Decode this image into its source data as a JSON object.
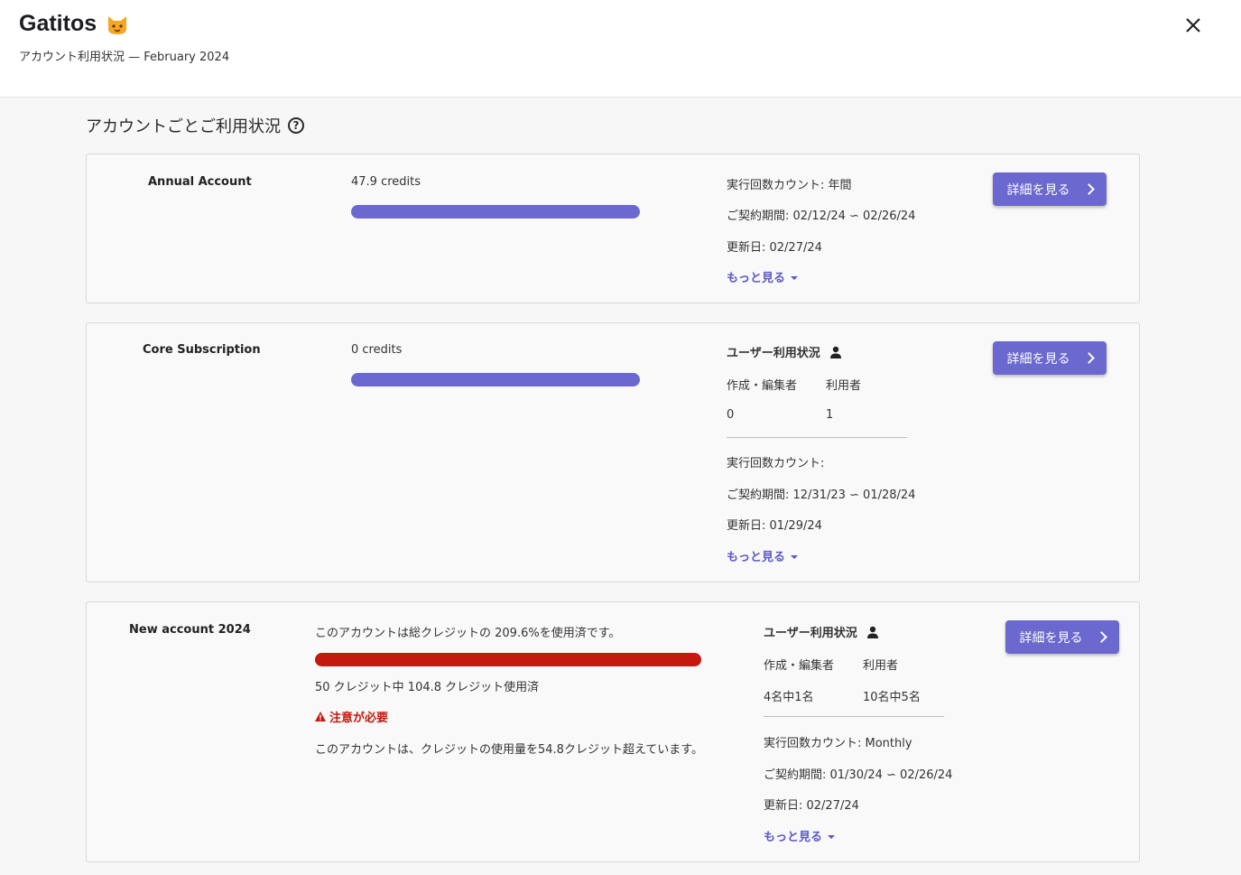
{
  "header": {
    "app_title": "Gatitos",
    "subtitle": "アカウント利用状況 — February 2024"
  },
  "section": {
    "title": "アカウントごとご利用状況"
  },
  "accounts": [
    {
      "name": "Annual Account",
      "credits": "47.9 credits",
      "usage_fraction": 1.0,
      "exec_count": "実行回数カウント: 年間",
      "contract": "ご契約期間: 02/12/24 ∽ 02/26/24",
      "renewal": "更新日: 02/27/24",
      "more_label": "もっと見る",
      "detail_label": "詳細を見る"
    },
    {
      "name": "Core Subscription",
      "credits": "0 credits",
      "usage_fraction": 1.0,
      "user_usage_title": "ユーザー利用状況",
      "editors_label": "作成・編集者",
      "users_label": "利用者",
      "editors_value": "0",
      "users_value": "1",
      "exec_count": "実行回数カウント:",
      "contract": "ご契約期間: 12/31/23 ∽ 01/28/24",
      "renewal": "更新日: 01/29/24",
      "more_label": "もっと見る",
      "detail_label": "詳細を見る"
    },
    {
      "name": "New account 2024",
      "usage_text": "このアカウントは総クレジットの 209.6%を使用済です。",
      "usage_fraction": 1.0,
      "credits_used_text": "50 クレジット中 104.8 クレジット使用済",
      "warning_label": "注意が必要",
      "warning_text": "このアカウントは、クレジットの使用量を54.8クレジット超えています。",
      "user_usage_title": "ユーザー利用状況",
      "editors_label": "作成・編集者",
      "users_label": "利用者",
      "editors_value": "4名中1名",
      "users_value": "10名中5名",
      "exec_count": "実行回数カウント: Monthly",
      "contract": "ご契約期間: 01/30/24 ∽ 02/26/24",
      "renewal": "更新日: 02/27/24",
      "more_label": "もっと見る",
      "detail_label": "詳細を見る"
    }
  ],
  "colors": {
    "accent": "#6b68cf",
    "danger": "#c4190f",
    "link": "#5b58c6"
  }
}
